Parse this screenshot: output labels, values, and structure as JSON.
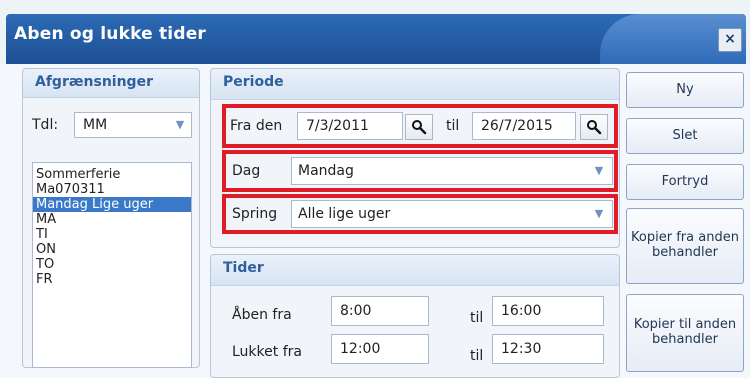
{
  "window": {
    "title": "Aben og lukke tider",
    "close_label": "×"
  },
  "afgraensninger": {
    "title": "Afgrænsninger",
    "tdl_label": "Tdl:",
    "tdl_value": "MM",
    "items": [
      "Sommerferie",
      "Ma070311",
      "Mandag Lige uger",
      "MA",
      "TI",
      "ON",
      "TO",
      "FR"
    ],
    "selected_index": 2
  },
  "periode": {
    "title": "Periode",
    "fra_label": "Fra den",
    "fra_value": "7/3/2011",
    "til_label": "til",
    "til_value": "26/7/2015",
    "dag_label": "Dag",
    "dag_value": "Mandag",
    "spring_label": "Spring",
    "spring_value": "Alle lige uger"
  },
  "tider": {
    "title": "Tider",
    "rows": [
      {
        "label": "Åben fra",
        "from": "8:00",
        "til_label": "til",
        "to": "16:00"
      },
      {
        "label": "Lukket fra",
        "from": "12:00",
        "til_label": "til",
        "to": "12:30"
      }
    ]
  },
  "buttons": {
    "ny": "Ny",
    "slet": "Slet",
    "fortryd": "Fortryd",
    "kopier_fra": "Kopier fra anden behandler",
    "kopier_til": "Kopier til anden behandler"
  },
  "colors": {
    "title_bar": "#1d4f93",
    "highlight": "#e01c26",
    "selection": "#3a78c8"
  }
}
